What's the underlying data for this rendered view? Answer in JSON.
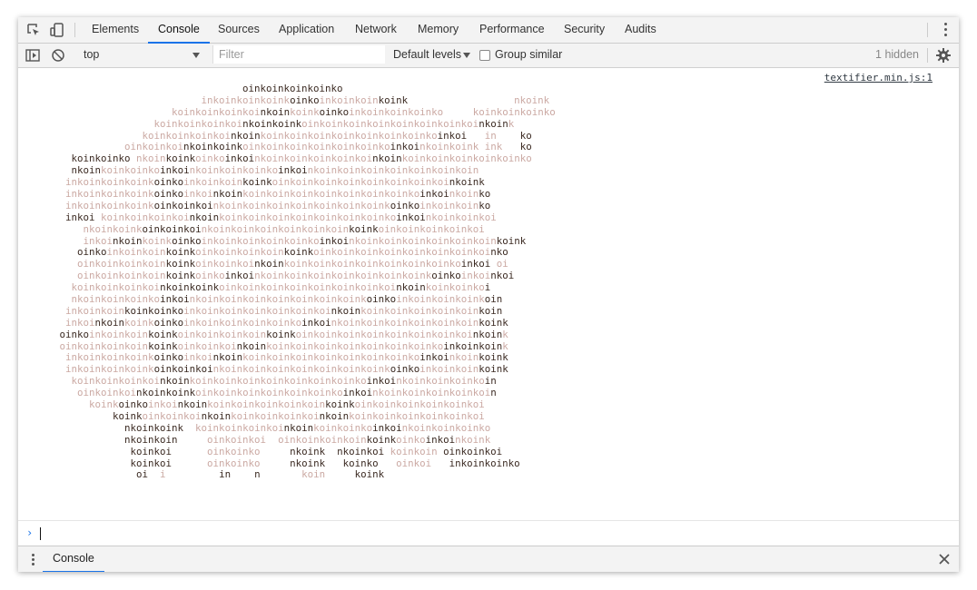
{
  "tabs": [
    {
      "label": "Elements",
      "active": false
    },
    {
      "label": "Console",
      "active": true
    },
    {
      "label": "Sources",
      "active": false
    },
    {
      "label": "Application",
      "active": false
    },
    {
      "label": "Network",
      "active": false
    },
    {
      "label": "Memory",
      "active": false
    },
    {
      "label": "Performance",
      "active": false
    },
    {
      "label": "Security",
      "active": false
    },
    {
      "label": "Audits",
      "active": false
    }
  ],
  "icons": {
    "inspect": "inspect-element-icon",
    "device": "device-toolbar-icon",
    "menu": "more-vert-icon",
    "sidebar": "sidebar-toggle-icon",
    "clear": "clear-console-icon",
    "settings": "gear-icon",
    "close": "close-icon"
  },
  "toolbar": {
    "context": "top",
    "filter_placeholder": "Filter",
    "levels": "Default levels",
    "group_similar": "Group similar",
    "hidden_count": "1 hidden"
  },
  "colors": {
    "accent": "#1a73e8",
    "art_strong": "#3b2a22",
    "art_faint": "#cba9a3"
  },
  "console": {
    "source": "textifier.min.js:1",
    "art_lines": [
      "                                      oinkoinkoinkoinko",
      "                               inkoinkoinkoinkoinkoinkoinkoinkoink                  nkoink",
      "                          koinkoinkoinkoinkoinkoinkoinkoinkoinkoinkoinko     koinkoinkoinko",
      "                       koinkoinkoinkoinkoinkoinkoinkoinkoinkoinkoinkoinkoinkoinkoink",
      "                     koinkoinkoinkoinkoinkoinkoinkoinkoinkoinkoinkoinkoinkoi   in    ko",
      "                  oinkoinkoinkoinkoinkoinkoinkoinkoinkoinkoinkoinkoinkoinkoink ink   ko",
      "         koinkoinko nkoinkoinkoinkoinkoinkoinkoinkoinkoinkoinkoinkoinkoinkoinkoinkoinko",
      "         nkoinkoinkoinkoinkoinkoinkoinkoinkoinkoinkoinkoinkoinkoinkoinkoinkoin",
      "        inkoinkoinkoinkoinkoinkoinkoinkoinkoinkoinkoinkoinkoinkoinkoinkoinkoink",
      "        inkoinkoinkoinkoinkoinkoinkoinkoinkoinkoinkoinkoinkoinkoinkoinkoinkoinko",
      "        inkoinkoinkoinkoinkoinkoinkoinkoinkoinkoinkoinkoinkoinkoinkoinkoinkoinko",
      "        inkoi koinkoinkoinkoinkoinkoinkoinkoinkoinkoinkoinkoinkoinkoinkoinkoinkoi",
      "           nkoinkoinkoinkoinkoinkoinkoinkoinkoinkoinkoinkoinkoinkoinkoinkoinkoi",
      "           inkoinkoinkoinkoinkoinkoinkoinkoinkoinkoinkoinkoinkoinkoinkoinkoinkoinkoink",
      "          oinkoinkoinkoinkoinkoinkoinkoinkoinkoinkoinkoinkoinkoinkoinkoinkoinkoinko",
      "          oinkoinkoinkoinkoinkoinkoinkoinkoinkoinkoinkoinkoinkoinkoinkoinkoinkoi oi",
      "          oinkoinkoinkoinkoinkoinkoinkoinkoinkoinkoinkoinkoinkoinkoinkoinkoinkoinkoi",
      "         koinkoinkoinkoinkoinkoinkoinkoinkoinkoinkoinkoinkoinkoinkoinkoinkoinkoi",
      "         nkoinkoinkoinkoinkoinkoinkoinkoinkoinkoinkoinkoinkoinkoinkoinkoinkoinkoin",
      "        inkoinkoinkoinkoinkoinkoinkoinkoinkoinkoinkoinkoinkoinkoinkoinkoinkoinkoin",
      "        inkoinkoinkoinkoinkoinkoinkoinkoinkoinkoinkoinkoinkoinkoinkoinkoinkoinkoink",
      "       oinkoinkoinkoinkoinkoinkoinkoinkoinkoinkoinkoinkoinkoinkoinkoinkoinkoinkoink",
      "       oinkoinkoinkoinkoinkoinkoinkoinkoinkoinkoinkoinkoinkoinkoinkoinkoinkoinkoink",
      "        inkoinkoinkoinkoinkoinkoinkoinkoinkoinkoinkoinkoinkoinkoinkoinkoinkoinkoink",
      "        inkoinkoinkoinkoinkoinkoinkoinkoinkoinkoinkoinkoinkoinkoinkoinkoinkoinkoink",
      "         koinkoinkoinkoinkoinkoinkoinkoinkoinkoinkoinkoinkoinkoinkoinkoinkoinkoin",
      "          oinkoinkoinkoinkoinkoinkoinkoinkoinkoinkoinkoinkoinkoinkoinkoinkoinkoin",
      "            koinkoinkoinkoinkoinkoinkoinkoinkoinkoinkoinkoinkoinkoinkoinkoinkoi",
      "                koinkoinkoinkoinkoinkoinkoinkoinkoinkoinkoinkoinkoinkoinkoinkoi",
      "                  nkoinkoink  koinkoinkoinkoinkoinkoinkoinkoinkoinkoinkoinkoinko",
      "                  nkoinkoin     oinkoinkoi  oinkoinkoinkoinkoinkoinkoinkoinkoink",
      "                   koinkoi      oinkoinko     nkoink  nkoinkoi koinkoin oinkoinkoi",
      "                   koinkoi      oinkoinko     nkoink   koinko   oinkoi   inkoinkoinko",
      "                    oi  i         in    n       koin     koink"
    ]
  },
  "drawer": {
    "tab": "Console"
  }
}
